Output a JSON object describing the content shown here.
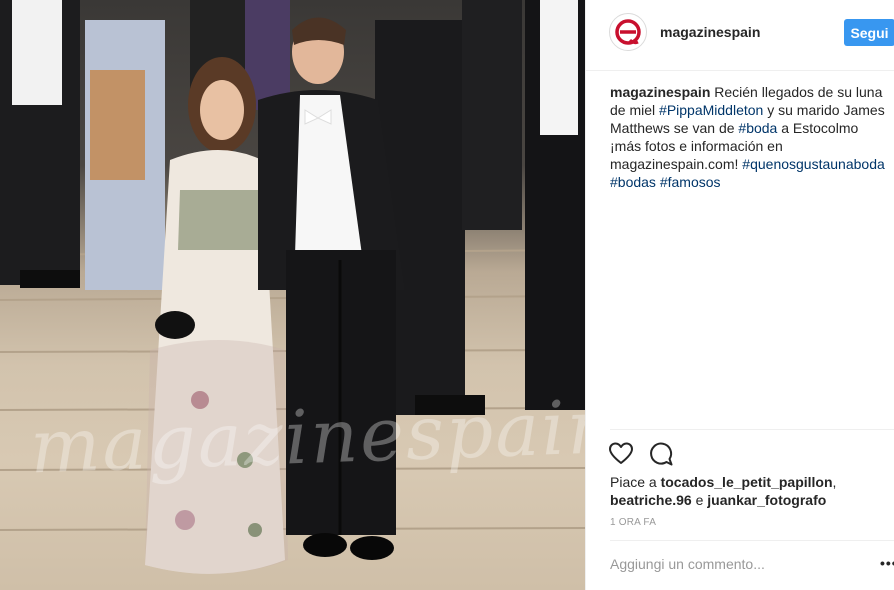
{
  "post": {
    "photo": {
      "watermark": "magazinespain"
    },
    "header": {
      "avatar_icon": "magazinespain-logo-icon",
      "username": "magazinespain",
      "follow_label": "Segui"
    },
    "caption": {
      "username": "magazinespain",
      "text_1": "Recién llegados de su luna de miel ",
      "tag_1": "#PippaMiddleton",
      "text_2": " y su marido James Matthews se van de ",
      "tag_2": "#boda",
      "text_3": " a Estocolmo ¡más fotos e información en magazinespain.com! ",
      "tag_3": "#quenosgustaunaboda",
      "tag_4": "#bodas",
      "tag_5": "#famosos"
    },
    "actions": {
      "like_icon": "heart-icon",
      "comment_icon": "comment-icon"
    },
    "likes": {
      "prefix": "Piace a ",
      "user_1": "tocados_le_petit_papillon",
      "sep_1": ",",
      "user_2": "beatriche.96",
      "sep_2": " e ",
      "user_3": "juankar_fotografo"
    },
    "timestamp": "1 ORA FA",
    "comment": {
      "placeholder": "Aggiungi un commento...",
      "more_label": "•••"
    }
  },
  "colors": {
    "accent": "#3897f0",
    "hashtag": "#003569",
    "logo": "#c8102e",
    "muted": "#999999"
  }
}
